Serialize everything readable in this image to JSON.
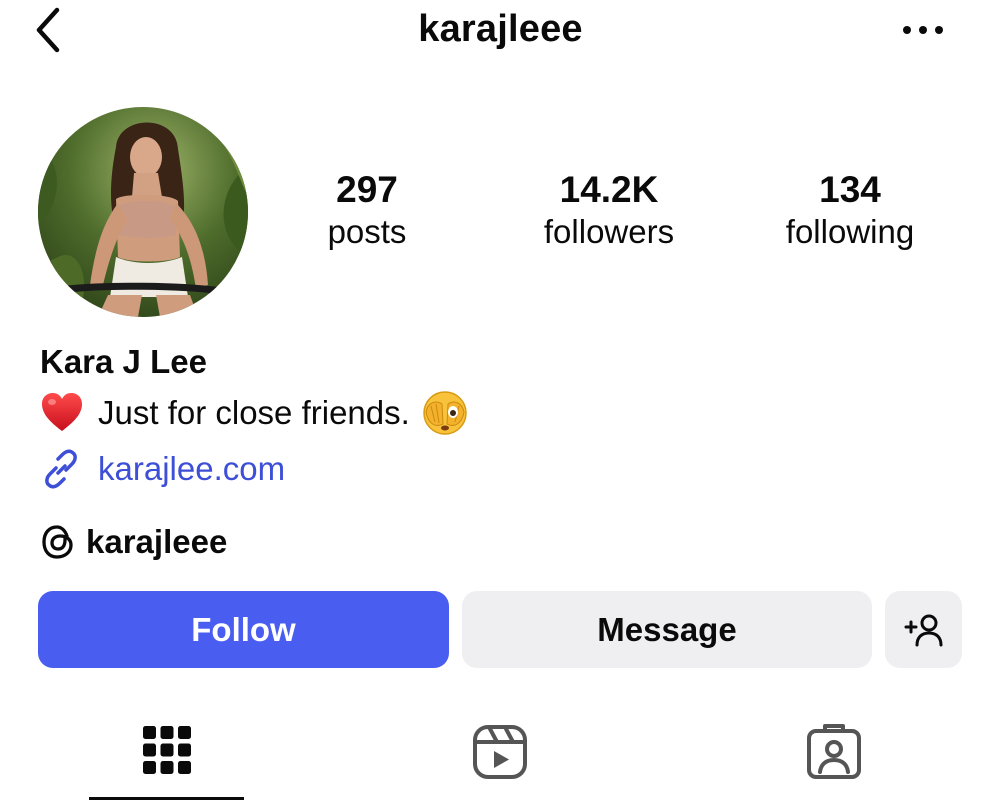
{
  "header": {
    "username": "karajleee",
    "back_icon": "chevron-left-icon",
    "more_icon": "more-horizontal-icon"
  },
  "profile": {
    "avatar_alt": "profile photo",
    "stats": {
      "posts": {
        "value": "297",
        "label": "posts"
      },
      "followers": {
        "value": "14.2K",
        "label": "followers"
      },
      "following": {
        "value": "134",
        "label": "following"
      }
    },
    "display_name": "Kara J Lee",
    "bio": {
      "prefix_emoji": "heart-emoji",
      "text": "Just for close friends.",
      "suffix_emoji": "face-with-peeking-eye-emoji"
    },
    "link": {
      "text": "karajlee.com",
      "icon": "link-icon"
    },
    "threads": {
      "handle": "karajleee",
      "icon": "threads-icon"
    }
  },
  "actions": {
    "follow_label": "Follow",
    "message_label": "Message",
    "suggest_icon": "add-person-icon"
  },
  "tabs": [
    {
      "name": "grid",
      "icon": "grid-icon",
      "active": true
    },
    {
      "name": "reels",
      "icon": "reels-icon",
      "active": false
    },
    {
      "name": "tagged",
      "icon": "tagged-person-icon",
      "active": false
    }
  ],
  "colors": {
    "accent": "#4a5df1",
    "link": "#3d4fd6",
    "secondary_button": "#efeff1",
    "text": "#0a0a0a",
    "background": "#ffffff"
  }
}
